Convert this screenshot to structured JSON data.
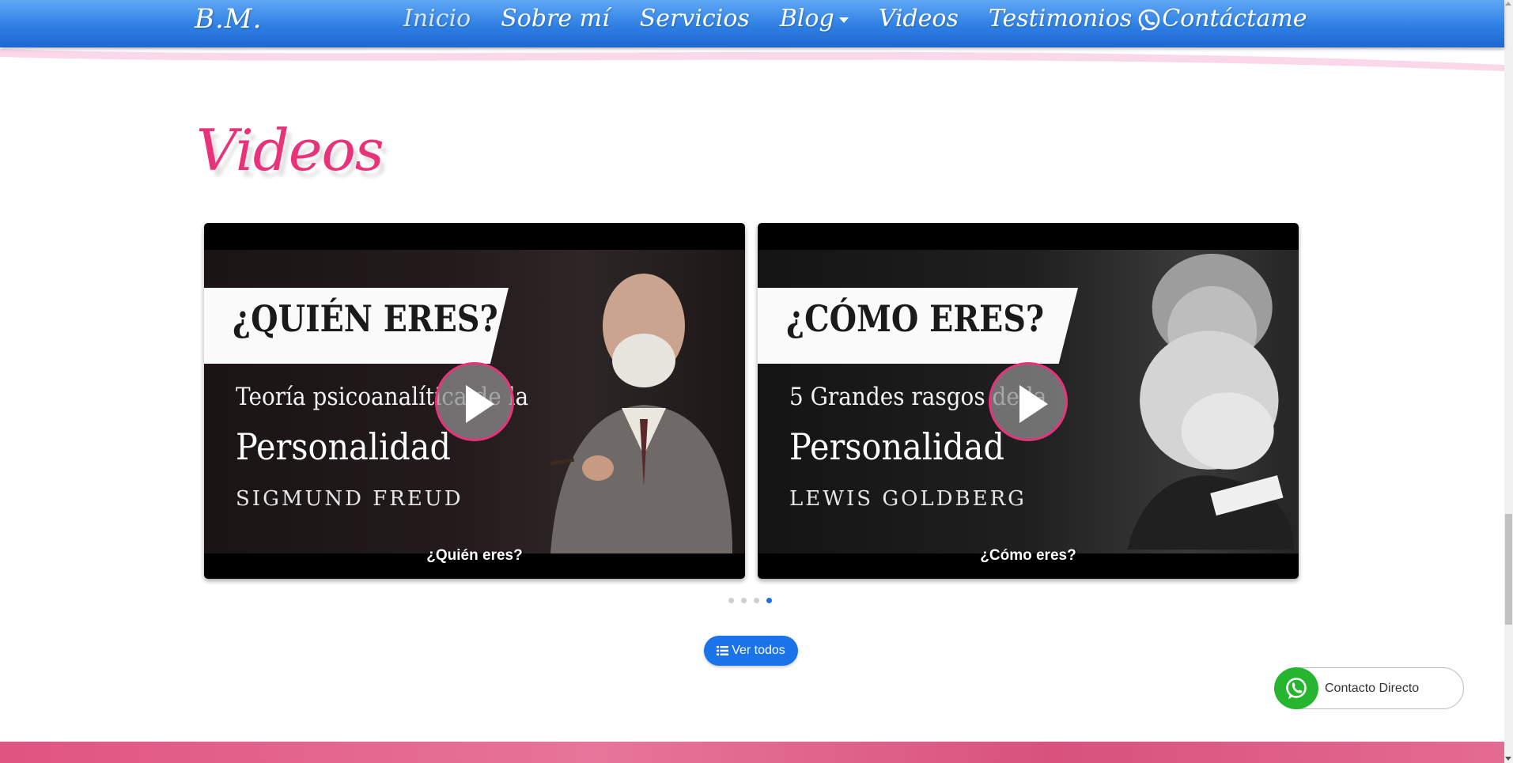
{
  "navbar": {
    "brand": "B.M.",
    "items": [
      {
        "label": "Inicio",
        "active": true
      },
      {
        "label": "Sobre mí"
      },
      {
        "label": "Servicios"
      },
      {
        "label": "Blog",
        "dropdown": true
      },
      {
        "label": "Videos"
      },
      {
        "label": "Testimonios"
      },
      {
        "label": "Contáctame"
      }
    ],
    "whatsapp_icon": "whatsapp-icon"
  },
  "section": {
    "title": "Videos"
  },
  "videos": [
    {
      "caption": "¿Quién eres?",
      "thumb_banner": "¿QUIÉN ERES?",
      "thumb_subtitle": "Teoría psicoanalítica de la",
      "thumb_title": "Personalidad",
      "thumb_author": "SIGMUND FREUD"
    },
    {
      "caption": "¿Cómo eres?",
      "thumb_banner": "¿CÓMO ERES?",
      "thumb_subtitle": "5 Grandes rasgos de la",
      "thumb_title": "Personalidad",
      "thumb_author": "LEWIS GOLDBERG"
    }
  ],
  "carousel": {
    "dots": 4,
    "active_index": 3
  },
  "ver_todos": {
    "label": "Ver todos",
    "icon": "list-icon"
  },
  "contact": {
    "label": "Contacto Directo",
    "icon": "whatsapp-icon"
  },
  "colors": {
    "nav_blue": "#2f7fe3",
    "accent_pink": "#e8337a",
    "button_blue": "#1a73e8",
    "whatsapp_green": "#25b52f"
  }
}
